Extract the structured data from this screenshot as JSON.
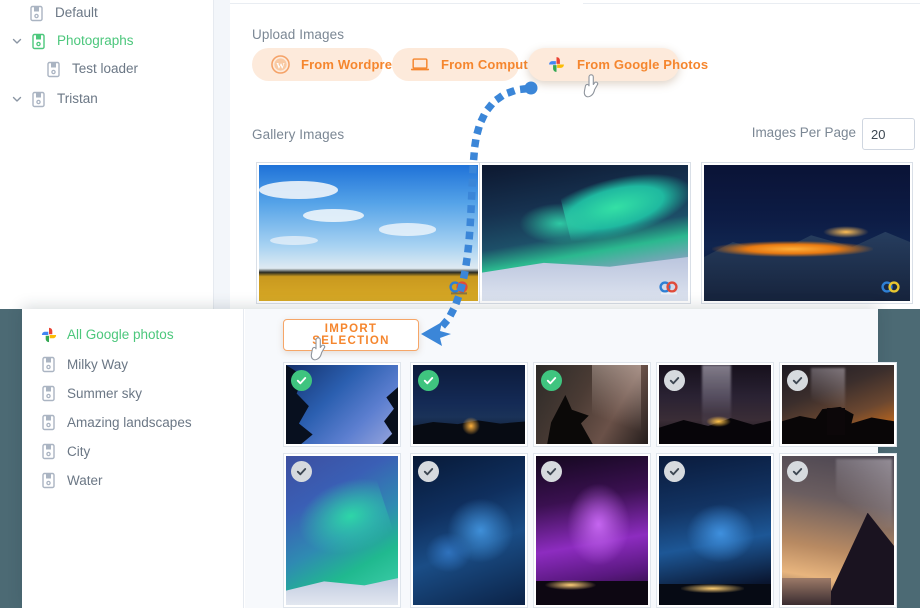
{
  "theme": {
    "accent_orange": "#f5862e",
    "button_bg": "#fdeadb",
    "green": "#4cc77c",
    "arrow_blue": "#3b86d8",
    "page_backdrop": "#4c6a74",
    "panel_bg": "#f7f9fc",
    "text_muted": "#7b8794"
  },
  "tree": {
    "items": [
      {
        "label": "Default",
        "icon": "document-icon",
        "indent": 0,
        "caret": false,
        "active": false
      },
      {
        "label": "Photographs",
        "icon": "document-icon",
        "indent": 0,
        "caret": true,
        "active": true
      },
      {
        "label": "Test loader",
        "icon": "document-icon",
        "indent": 1,
        "caret": false,
        "active": false
      },
      {
        "label": "Tristan",
        "icon": "document-icon",
        "indent": 0,
        "caret": true,
        "active": false
      }
    ]
  },
  "upload": {
    "title": "Upload Images",
    "buttons": [
      {
        "label": "From Wordpress",
        "icon": "wordpress-icon",
        "raised": false
      },
      {
        "label": "From Computer",
        "icon": "laptop-icon",
        "raised": false
      },
      {
        "label": "From Google Photos",
        "icon": "google-photos-icon",
        "raised": true
      }
    ]
  },
  "gallery": {
    "title": "Gallery Images",
    "images_per_page_label": "Images Per Page",
    "images_per_page_value": "20",
    "images_per_page_placeholder": "20",
    "thumbs": [
      {
        "alt": "yellow canola field under blue sky with clouds",
        "watermark": true
      },
      {
        "alt": "green aurora borealis over snowy river",
        "watermark": true
      },
      {
        "alt": "night mountain village lights",
        "watermark": true
      }
    ]
  },
  "google_photos": {
    "import_button": "IMPORT SELECTION",
    "albums": [
      {
        "label": "All Google photos",
        "icon": "google-photos-icon",
        "active": true
      },
      {
        "label": "Milky Way",
        "icon": "document-icon",
        "active": false
      },
      {
        "label": "Summer sky",
        "icon": "document-icon",
        "active": false
      },
      {
        "label": "Amazing landscapes",
        "icon": "document-icon",
        "active": false
      },
      {
        "label": "City",
        "icon": "document-icon",
        "active": false
      },
      {
        "label": "Water",
        "icon": "document-icon",
        "active": false
      }
    ],
    "photos": [
      {
        "alt": "star trails over pine trees",
        "selected": true
      },
      {
        "alt": "campfire on dark field at night",
        "selected": true
      },
      {
        "alt": "telescope silhouette and milky way",
        "selected": true
      },
      {
        "alt": "milky way over mountain ridge",
        "selected": false
      },
      {
        "alt": "delicate arch under starry sky",
        "selected": false
      },
      {
        "alt": "aurora over snow field",
        "selected": false
      },
      {
        "alt": "blue starfield galaxy",
        "selected": false
      },
      {
        "alt": "purple milky way over town",
        "selected": false
      },
      {
        "alt": "blue night sky over coastal town",
        "selected": false
      },
      {
        "alt": "milky way over dark headland",
        "selected": false
      }
    ]
  },
  "annotation": {
    "arrow_label": "dotted-guide-arrow",
    "from": "From Google Photos button",
    "to": "IMPORT SELECTION button"
  },
  "cursors": [
    {
      "name": "pointer-cursor-google-photos"
    },
    {
      "name": "pointer-cursor-import-selection"
    }
  ]
}
